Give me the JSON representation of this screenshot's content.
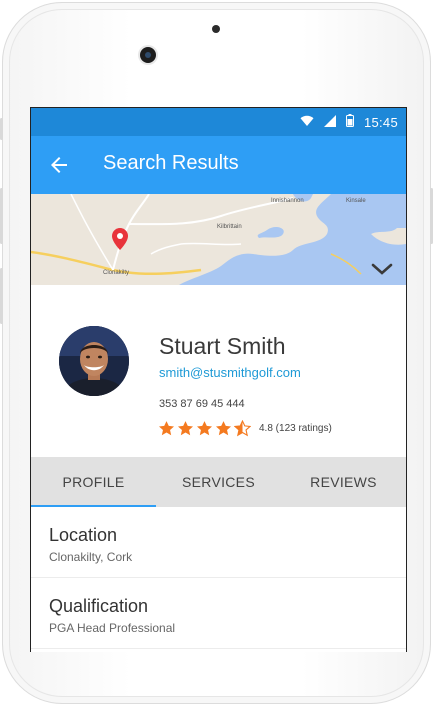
{
  "status_bar": {
    "time": "15:45"
  },
  "app_bar": {
    "title": "Search Results"
  },
  "profile": {
    "name": "Stuart Smith",
    "email": "smith@stusmithgolf.com",
    "phone": "353 87 69 45 444",
    "rating_value": 4.8,
    "rating_text": "4.8 (123 ratings)"
  },
  "tabs": [
    {
      "label": "PROFILE",
      "active": true
    },
    {
      "label": "SERVICES",
      "active": false
    },
    {
      "label": "REVIEWS",
      "active": false
    }
  ],
  "details": [
    {
      "title": "Location",
      "value": "Clonakilty, Cork"
    },
    {
      "title": "Qualification",
      "value": "PGA Head Professional"
    }
  ],
  "map_labels": [
    "Clonakilty",
    "Kilbrittain",
    "Kinsale",
    "Innishannon"
  ],
  "colors": {
    "status_bar": "#1e88d8",
    "app_bar": "#2e9ef5",
    "email": "#1f9ad6",
    "star": "#f47a20",
    "tab_bg": "#e1e1e1",
    "pin": "#e8333b"
  },
  "icons": [
    "back-arrow-icon",
    "wifi-icon",
    "signal-icon",
    "battery-icon",
    "map-pin-icon",
    "chevron-down-icon",
    "star-icon",
    "half-star-icon"
  ]
}
